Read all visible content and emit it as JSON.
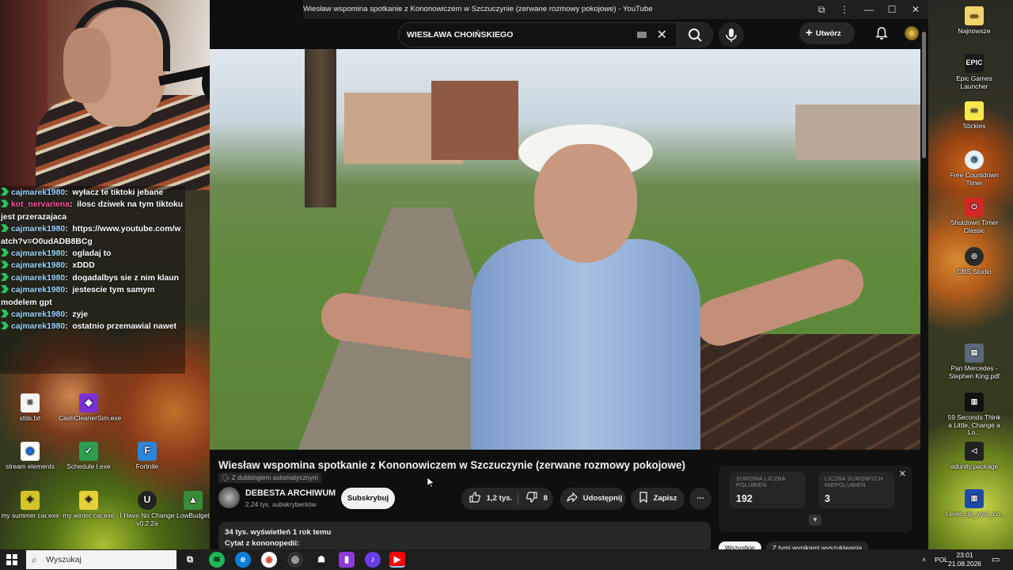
{
  "browser": {
    "window_title": "Wiesław wspomina spotkanie z Kononowiczem w Szczuczynie (zerwane rozmowy pokojowe) - YouTube"
  },
  "youtube": {
    "search_value": "WIESŁAWA CHOIŃSKIEGO",
    "create_label": "Utwórz",
    "video_title": "Wiesław wspomina spotkanie z Kononowiczem w Szczuczynie (zerwane rozmowy pokojowe)",
    "dubbing_label": "Z dubbingiem automatycznym",
    "channel_name": "DEBESTA ARCHIWUM",
    "channel_subs": "2,24 tys. subskrybentów",
    "subscribe_label": "Subskrybuj",
    "likes": "1,2 tys.",
    "dislikes": "8",
    "share_label": "Udostępnij",
    "save_label": "Zapisz",
    "more_label": "⋯",
    "desc_meta": "34 tys. wyświetleń  1 rok temu",
    "desc_text": "Cytat z kononopedii:",
    "stats": {
      "likes_label": "SUROWA LICZBA POLUBIEŃ",
      "likes_value": "192",
      "dislikes_label": "LICZBA SUROWYCH NIEPOLUBIEŃ",
      "dislikes_value": "3"
    },
    "chips": [
      "Wszystkie",
      "Z tymi wynikami wyszukiwania"
    ]
  },
  "chat": {
    "messages": [
      {
        "user": "cajmarek1980",
        "text": "wyłacz te tiktoki jebane"
      },
      {
        "user": "kot_nervariena",
        "text": "ilosc dziwek na tym tiktoku jest przerazajaca"
      },
      {
        "user": "cajmarek1980",
        "text": "https://www.youtube.com/watch?v=O0udADB8BCg"
      },
      {
        "user": "cajmarek1980",
        "text": "ogladaj to"
      },
      {
        "user": "cajmarek1980",
        "text": "xDDD"
      },
      {
        "user": "cajmarek1980",
        "text": "dogadalbys sie z nim klaun"
      },
      {
        "user": "cajmarek1980",
        "text": "jestescie tym samym modelem gpt"
      },
      {
        "user": "cajmarek1980",
        "text": "zyje"
      },
      {
        "user": "cajmarek1980",
        "text": "ostatnio przemawial nawet"
      }
    ]
  },
  "desktop_left": [
    {
      "label": "sfds.txt"
    },
    {
      "label": "CashCleanerSim.exe"
    },
    {
      "label": "stream elements"
    },
    {
      "label": "Schedule I.exe"
    },
    {
      "label": "Fortnite"
    },
    {
      "label": "my summer car.exe"
    },
    {
      "label": "my winter car.exe"
    },
    {
      "label": "I Have No Change v0.2.2a"
    },
    {
      "label": "LowBudget"
    }
  ],
  "desktop_right": [
    {
      "label": "Najnowsze"
    },
    {
      "label": "Epic Games Launcher"
    },
    {
      "label": "Stickies"
    },
    {
      "label": "Free Countdown Timer"
    },
    {
      "label": "Shutdown Timer Classic"
    },
    {
      "label": "OBS Studio"
    },
    {
      "label": "Pan Mercedes - Stephen King.pdf"
    },
    {
      "label": "59 Seconds Think a Little, Change a Lo..."
    },
    {
      "label": "adunity.package"
    },
    {
      "label": "Level_up_your_co..."
    }
  ],
  "taskbar": {
    "search_placeholder": "Wyszukaj",
    "lang": "POL",
    "time": "23:01",
    "date": "21.08.2026"
  }
}
